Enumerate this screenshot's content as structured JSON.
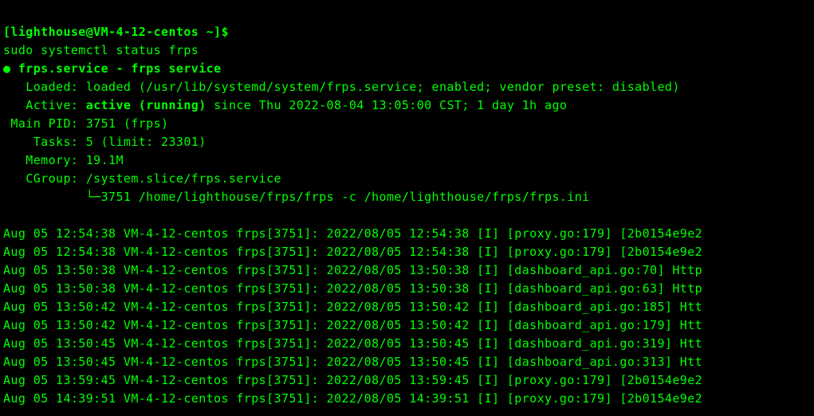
{
  "prompt": {
    "line": "[lighthouse@VM-4-12-centos ~]$ "
  },
  "command": "sudo systemctl status frps",
  "header": {
    "bullet": "●",
    "name_line": " frps.service - frps service",
    "loaded": "   Loaded: loaded (/usr/lib/systemd/system/frps.service; enabled; vendor preset: disabled)",
    "active_prefix": "   Active: ",
    "active_state": "active (running)",
    "active_tail": " since Thu 2022-08-04 13:05:00 CST; 1 day 1h ago",
    "mainpid": " Main PID: 3751 (frps)",
    "tasks": "    Tasks: 5 (limit: 23301)",
    "memory": "   Memory: 19.1M",
    "cgroup": "   CGroup: /system.slice/frps.service",
    "cgroup_child": "           └─3751 /home/lighthouse/frps/frps -c /home/lighthouse/frps/frps.ini"
  },
  "logs": [
    "Aug 05 12:54:38 VM-4-12-centos frps[3751]: 2022/08/05 12:54:38 [I] [proxy.go:179] [2b0154e9e2",
    "Aug 05 12:54:38 VM-4-12-centos frps[3751]: 2022/08/05 12:54:38 [I] [proxy.go:179] [2b0154e9e2",
    "Aug 05 13:50:38 VM-4-12-centos frps[3751]: 2022/08/05 13:50:38 [I] [dashboard_api.go:70] Http",
    "Aug 05 13:50:38 VM-4-12-centos frps[3751]: 2022/08/05 13:50:38 [I] [dashboard_api.go:63] Http",
    "Aug 05 13:50:42 VM-4-12-centos frps[3751]: 2022/08/05 13:50:42 [I] [dashboard_api.go:185] Htt",
    "Aug 05 13:50:42 VM-4-12-centos frps[3751]: 2022/08/05 13:50:42 [I] [dashboard_api.go:179] Htt",
    "Aug 05 13:50:45 VM-4-12-centos frps[3751]: 2022/08/05 13:50:45 [I] [dashboard_api.go:319] Htt",
    "Aug 05 13:50:45 VM-4-12-centos frps[3751]: 2022/08/05 13:50:45 [I] [dashboard_api.go:313] Htt",
    "Aug 05 13:59:45 VM-4-12-centos frps[3751]: 2022/08/05 13:59:45 [I] [proxy.go:179] [2b0154e9e2",
    "Aug 05 14:39:51 VM-4-12-centos frps[3751]: 2022/08/05 14:39:51 [I] [proxy.go:179] [2b0154e9e2"
  ]
}
